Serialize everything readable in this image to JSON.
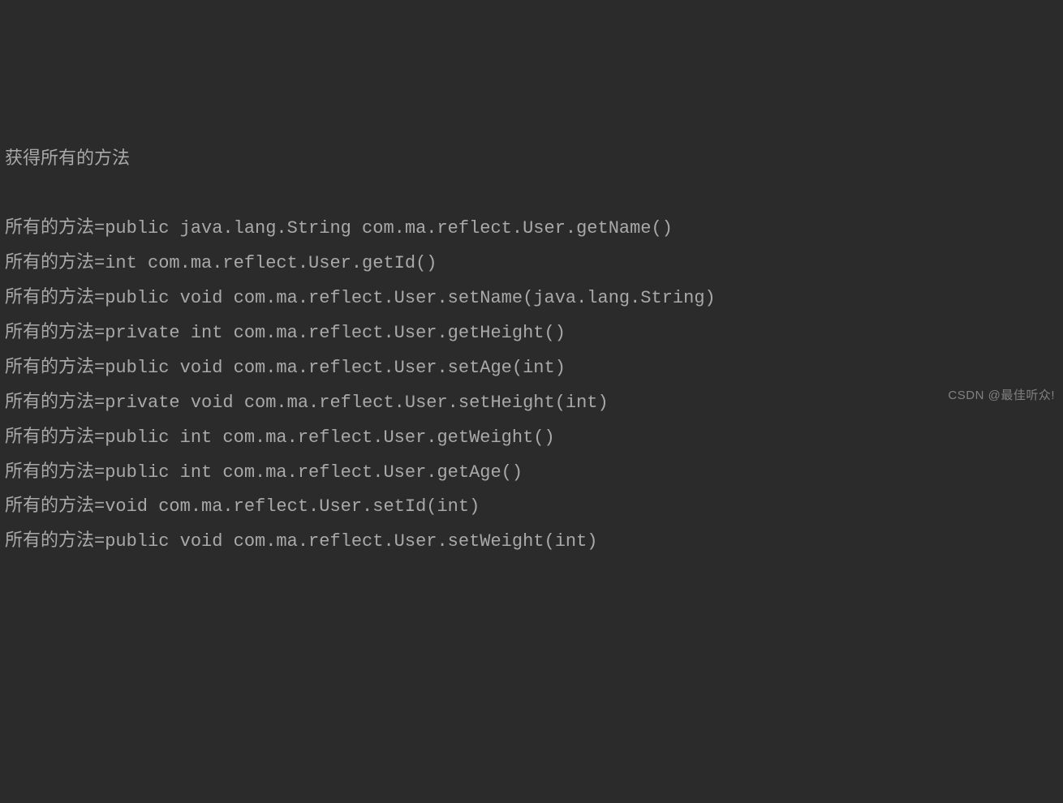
{
  "header": "获得所有的方法",
  "prefix": "所有的方法=",
  "methods": [
    "public java.lang.String com.ma.reflect.User.getName()",
    "int com.ma.reflect.User.getId()",
    "public void com.ma.reflect.User.setName(java.lang.String)",
    "private int com.ma.reflect.User.getHeight()",
    "public void com.ma.reflect.User.setAge(int)",
    "private void com.ma.reflect.User.setHeight(int)",
    "public int com.ma.reflect.User.getWeight()",
    "public int com.ma.reflect.User.getAge()",
    "void com.ma.reflect.User.setId(int)",
    "public void com.ma.reflect.User.setWeight(int)"
  ],
  "watermark": "CSDN @最佳听众!"
}
